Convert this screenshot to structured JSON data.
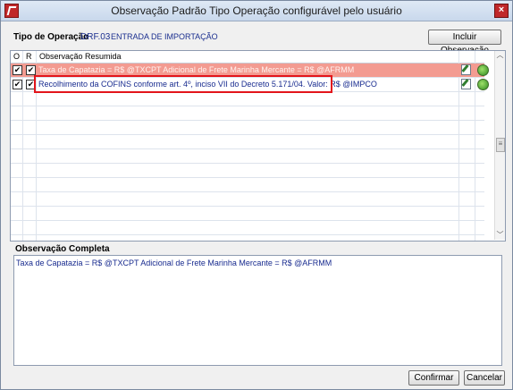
{
  "window": {
    "title": "Observação Padrão Tipo Operação configurável pelo usuário",
    "close_glyph": "×"
  },
  "operation": {
    "label": "Tipo de Operação",
    "code": "DRF.03",
    "name": "ENTRADA DE IMPORTAÇÃO"
  },
  "buttons": {
    "add_observation": "Incluir Observação",
    "confirm": "Confirmar",
    "cancel": "Cancelar"
  },
  "grid": {
    "columns": [
      "O",
      "R",
      "Observação Resumida"
    ],
    "rows": [
      {
        "o_checked": true,
        "r_checked": true,
        "text": "Taxa de Capatazia = R$ @TXCPT Adicional de Frete Marinha Mercante = R$ @AFRMM",
        "selected": true
      },
      {
        "o_checked": true,
        "r_checked": true,
        "text": "Recolhimento da COFINS conforme art. 4º, inciso VII do Decreto 5.171/04. Valor: R$ @IMPCO",
        "selected": false
      }
    ],
    "empty_row_count": 10
  },
  "complete": {
    "label": "Observação Completa",
    "text": "Taxa de Capatazia = R$ @TXCPT Adicional de Frete Marinha Mercante = R$ @AFRMM"
  },
  "icons": {
    "app": "app-logo-icon",
    "edit": "edit-pencil-icon",
    "copy": "green-refresh-icon"
  },
  "colors": {
    "selected_row": "#f39b91",
    "highlight_border": "#e3151b",
    "text_blue": "#182b8f"
  }
}
